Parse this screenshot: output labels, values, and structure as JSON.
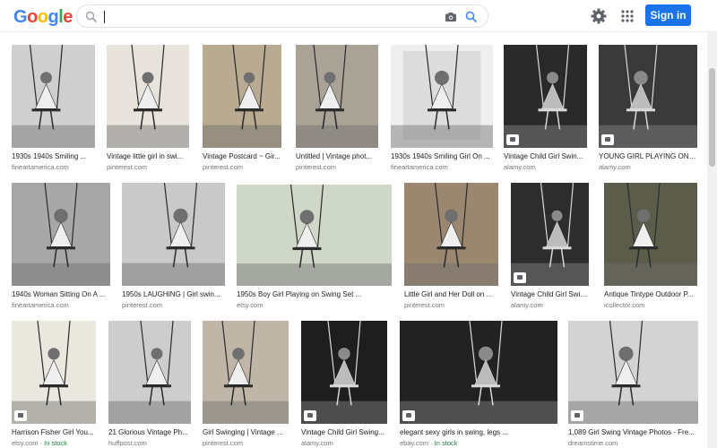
{
  "logo": "Google",
  "search": {
    "value": "",
    "placeholder": ""
  },
  "header": {
    "signin_label": "Sign in"
  },
  "icons": {
    "search": "search-icon",
    "camera": "camera-icon",
    "settings": "gear-icon",
    "apps": "apps-grid-icon"
  },
  "colors": {
    "accent": "#1a73e8",
    "in_stock": "#188038"
  },
  "results": [
    {
      "title": "1930s 1940s Smiling ...",
      "source": "fineartamerica.com"
    },
    {
      "title": "Vintage little girl in swi...",
      "source": "pinterest.com"
    },
    {
      "title": "Vintage Postcard ~ Gir...",
      "source": "pinterest.com"
    },
    {
      "title": "Untitled | Vintage phot...",
      "source": "pinterest.com"
    },
    {
      "title": "1930s 1940s Smiling Girl On ...",
      "source": "fineartamerica.com"
    },
    {
      "title": "Vintage Child Girl Swin...",
      "source": "alamy.com"
    },
    {
      "title": "YOUNG GIRL PLAYING ON S...",
      "source": "alamy.com"
    },
    {
      "title": "1940s Woman Sitting On A ...",
      "source": "fineartamerica.com"
    },
    {
      "title": "1950s LAUGHING | Girl swin...",
      "source": "pinterest.com"
    },
    {
      "title": "1950s Boy Girl Playing on Swing Set ...",
      "source": "etsy.com"
    },
    {
      "title": "Little Girl and Her Doll on ...",
      "source": "pinterest.com"
    },
    {
      "title": "Vintage Child Girl Swin...",
      "source": "alamy.com"
    },
    {
      "title": "Antique Tintype Outdoor P...",
      "source": "icollector.com"
    },
    {
      "title": "Harrison Fisher Girl You...",
      "source": "etsy.com",
      "stock": "In stock"
    },
    {
      "title": "21 Glorious Vintage Ph...",
      "source": "huffpost.com"
    },
    {
      "title": "Girl Swinging | Vintage ...",
      "source": "pinterest.com"
    },
    {
      "title": "Vintage Child Girl Swing...",
      "source": "alamy.com"
    },
    {
      "title": "elegant sexy girls in swing, legs ...",
      "source": "ebay.com",
      "stock": "In stock"
    },
    {
      "title": "1,089 Girl Swing Vintage Photos - Fre...",
      "source": "dreamstime.com"
    }
  ]
}
